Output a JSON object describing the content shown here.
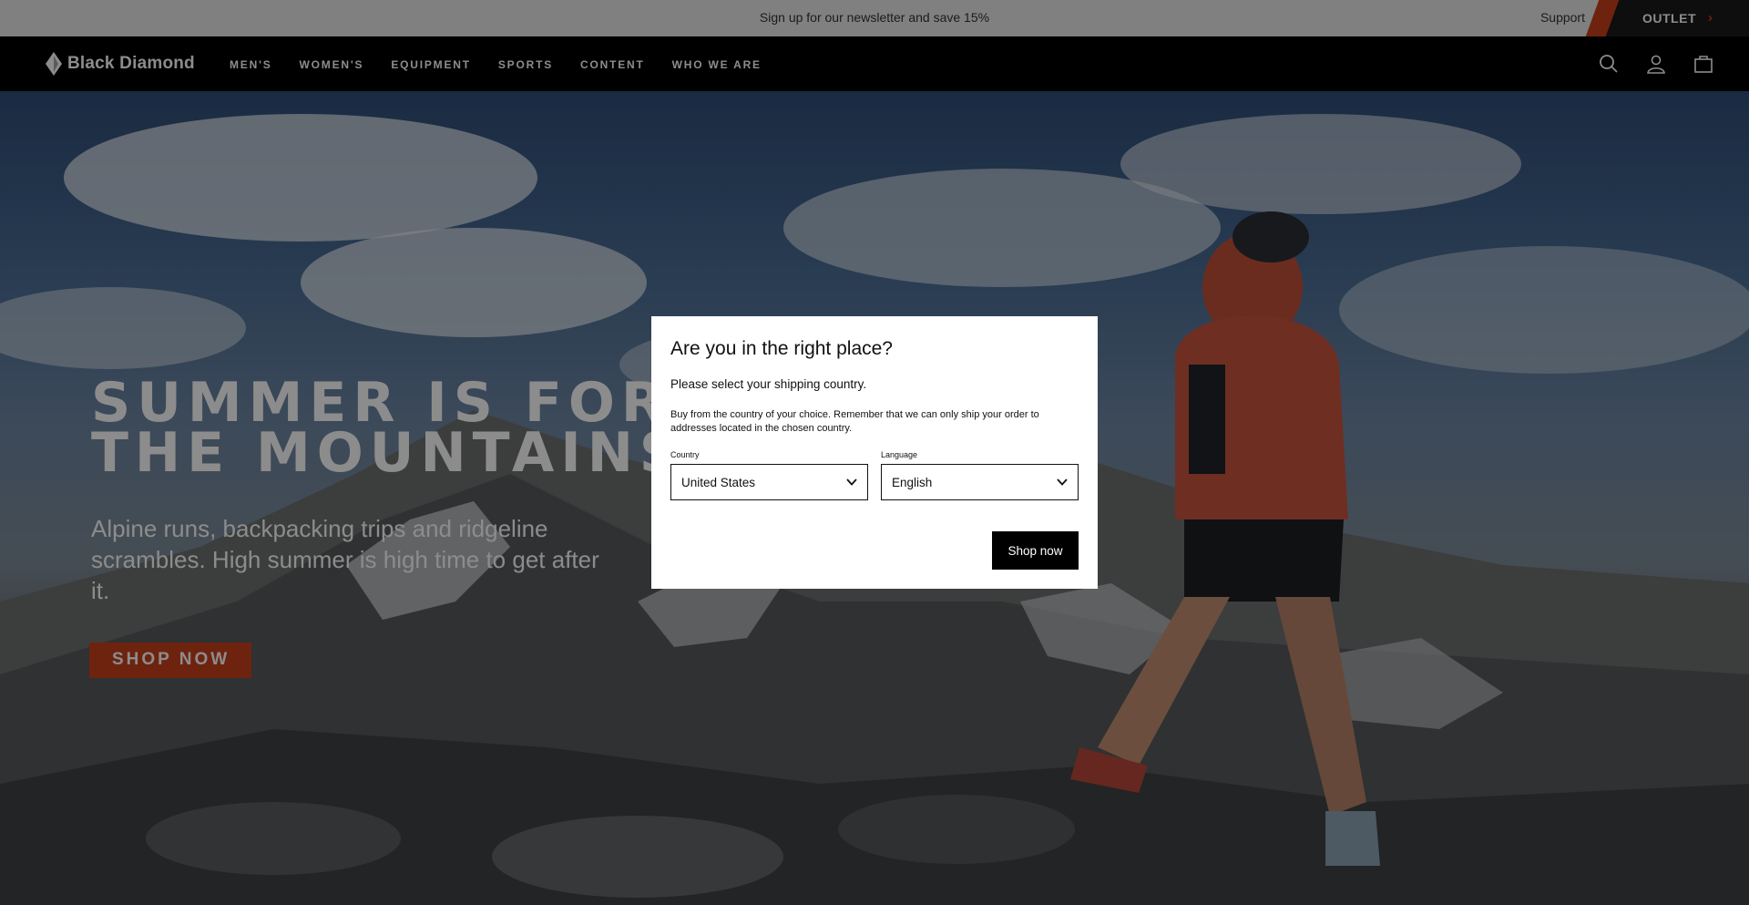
{
  "announcement": {
    "promo": "Sign up for our newsletter and save 15%",
    "support": "Support",
    "outlet": "OUTLET"
  },
  "nav": {
    "logo": "Black Diamond",
    "links": [
      "MEN'S",
      "WOMEN'S",
      "EQUIPMENT",
      "SPORTS",
      "CONTENT",
      "WHO WE ARE"
    ],
    "icons": [
      "search-icon",
      "account-icon",
      "cart-icon"
    ]
  },
  "hero": {
    "title_line1": "SUMMER IS FOR",
    "title_line2": "THE MOUNTAINS",
    "subtitle": "Alpine runs, backpacking trips and ridgeline scrambles. High summer is high time to get after it.",
    "cta": "SHOP NOW"
  },
  "modal": {
    "title": "Are you in the right place?",
    "lead": "Please select your shipping country.",
    "note": "Buy from the country of your choice. Remember that we can only ship your order to addresses located in the chosen country.",
    "country_label": "Country",
    "country_value": "United States",
    "language_label": "Language",
    "language_value": "English",
    "submit": "Shop now"
  },
  "colors": {
    "accent": "#c8411c",
    "nav_bg": "#000000",
    "announce_bg": "#e9e9e9"
  }
}
